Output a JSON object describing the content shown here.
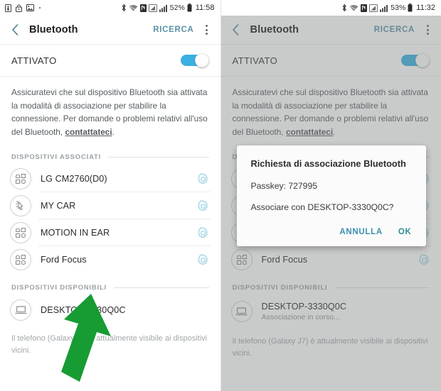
{
  "left": {
    "status_bar": {
      "icons_left": [
        "sim-card-icon",
        "lock-icon",
        "screenshot-icon",
        "dot-icon"
      ],
      "icons_right": [
        "bluetooth-icon",
        "wifi-icon",
        "nfc-icon",
        "signal-icon",
        "signal-bars-icon"
      ],
      "battery_percent": "52%",
      "time": "11:58"
    },
    "action_bar": {
      "title": "Bluetooth",
      "search_label": "RICERCA",
      "back_icon": "chevron-left-icon",
      "overflow_icon": "kebab-menu-icon"
    },
    "toggle": {
      "label": "ATTIVATO",
      "state": "on"
    },
    "description": {
      "text_before": "Assicuratevi che sul dispositivo Bluetooth sia attivata la modalità di associazione per stabilire la connessione. Per domande o problemi relativi all'uso del Bluetooth, ",
      "link": "contattateci",
      "text_after": "."
    },
    "paired_section": {
      "label": "DISPOSITIVI ASSOCIATI"
    },
    "paired_devices": [
      {
        "name": "LG CM2760(D0)",
        "icon": "bluetooth-device-icon",
        "action_icon": "gear-icon"
      },
      {
        "name": "MY CAR",
        "icon": "touch-pointer-icon",
        "action_icon": "gear-icon"
      },
      {
        "name": "MOTION IN EAR",
        "icon": "bluetooth-device-icon",
        "action_icon": "gear-icon"
      },
      {
        "name": "Ford Focus",
        "icon": "bluetooth-device-icon",
        "action_icon": "gear-icon"
      }
    ],
    "available_section": {
      "label": "DISPOSITIVI DISPONIBILI"
    },
    "available_devices": [
      {
        "name": "DESKTOP-3330Q0C",
        "status": "",
        "icon": "laptop-icon"
      }
    ],
    "footnote": "Il telefono (Galaxy J7) è attualmente visibile ai dispositivi vicini."
  },
  "right": {
    "status_bar": {
      "icons_left": [],
      "icons_right": [
        "bluetooth-icon",
        "wifi-icon",
        "nfc-icon",
        "signal-icon",
        "signal-bars-icon"
      ],
      "battery_percent": "53%",
      "time": "11:32"
    },
    "action_bar": {
      "title": "Bluetooth",
      "search_label": "RICERCA",
      "back_icon": "chevron-left-icon",
      "overflow_icon": "kebab-menu-icon"
    },
    "toggle": {
      "label": "ATTIVATO",
      "state": "on"
    },
    "description": {
      "text_before": "Assicuratevi che sul dispositivo Bluetooth sia attivata la modalità di associazione per stabilire la connessione. Per domande o problemi relativi all'uso del Bluetooth, ",
      "link": "contattateci",
      "text_after": "."
    },
    "paired_section": {
      "label": "DISPOSITIVI ASSOCIATI"
    },
    "paired_devices": [
      {
        "name": "LG CM2760(D0)",
        "icon": "bluetooth-device-icon",
        "action_icon": "gear-icon"
      },
      {
        "name": "MY CAR",
        "icon": "touch-pointer-icon",
        "action_icon": "gear-icon"
      },
      {
        "name": "MOTION IN EAR",
        "icon": "bluetooth-device-icon",
        "action_icon": "gear-icon"
      },
      {
        "name": "Ford Focus",
        "icon": "bluetooth-device-icon",
        "action_icon": "gear-icon"
      }
    ],
    "available_section": {
      "label": "DISPOSITIVI DISPONIBILI"
    },
    "available_devices": [
      {
        "name": "DESKTOP-3330Q0C",
        "status": "Associazione in corso...",
        "icon": "laptop-icon"
      }
    ],
    "footnote": "Il telefono (Galaxy J7) è attualmente visibile ai dispositivi vicini.",
    "dialog": {
      "title": "Richiesta di associazione Bluetooth",
      "passkey_line": "Passkey: 727995",
      "confirm_line": "Associare con DESKTOP-3330Q0C?",
      "cancel_label": "ANNULLA",
      "ok_label": "OK"
    }
  },
  "annotations": {
    "arrow_color": "#179b33",
    "left_arrow_target": "DESKTOP-3330Q0C",
    "right_arrow_target": "OK"
  },
  "colors": {
    "accent_teal": "#5a93a8",
    "toggle_on": "#3ab0e2",
    "gear": "#9fd3e4",
    "arrow_green": "#179b33",
    "scrim": "rgba(120,124,126,0.40)"
  }
}
